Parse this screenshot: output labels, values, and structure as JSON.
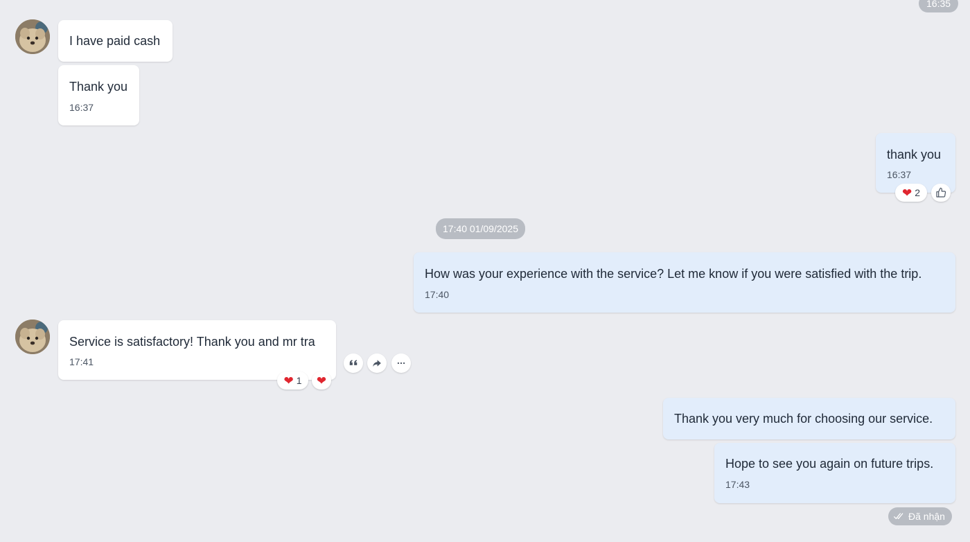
{
  "top_time_pill": "16:35",
  "date_separator": "17:40 01/09/2025",
  "messages": [
    {
      "text": "I have paid cash"
    },
    {
      "text": "Thank you",
      "time": "16:37"
    },
    {
      "text": "thank you",
      "time": "16:37",
      "reaction_count": "2"
    },
    {
      "text": "How was your experience with the service? Let me know if you were satisfied with the trip.",
      "time": "17:40"
    },
    {
      "text": "Service is satisfactory! Thank you and mr tra",
      "time": "17:41",
      "reaction_count": "1"
    },
    {
      "text": "Thank you very much for choosing our service."
    },
    {
      "text": "Hope to see you again on future trips.",
      "time": "17:43"
    }
  ],
  "status_label": "Đã nhận",
  "icons": {
    "heart": "heart-icon",
    "like": "thumbs-up-icon",
    "quote": "quote-icon",
    "share": "share-icon",
    "more": "more-icon",
    "check": "double-check-icon"
  }
}
